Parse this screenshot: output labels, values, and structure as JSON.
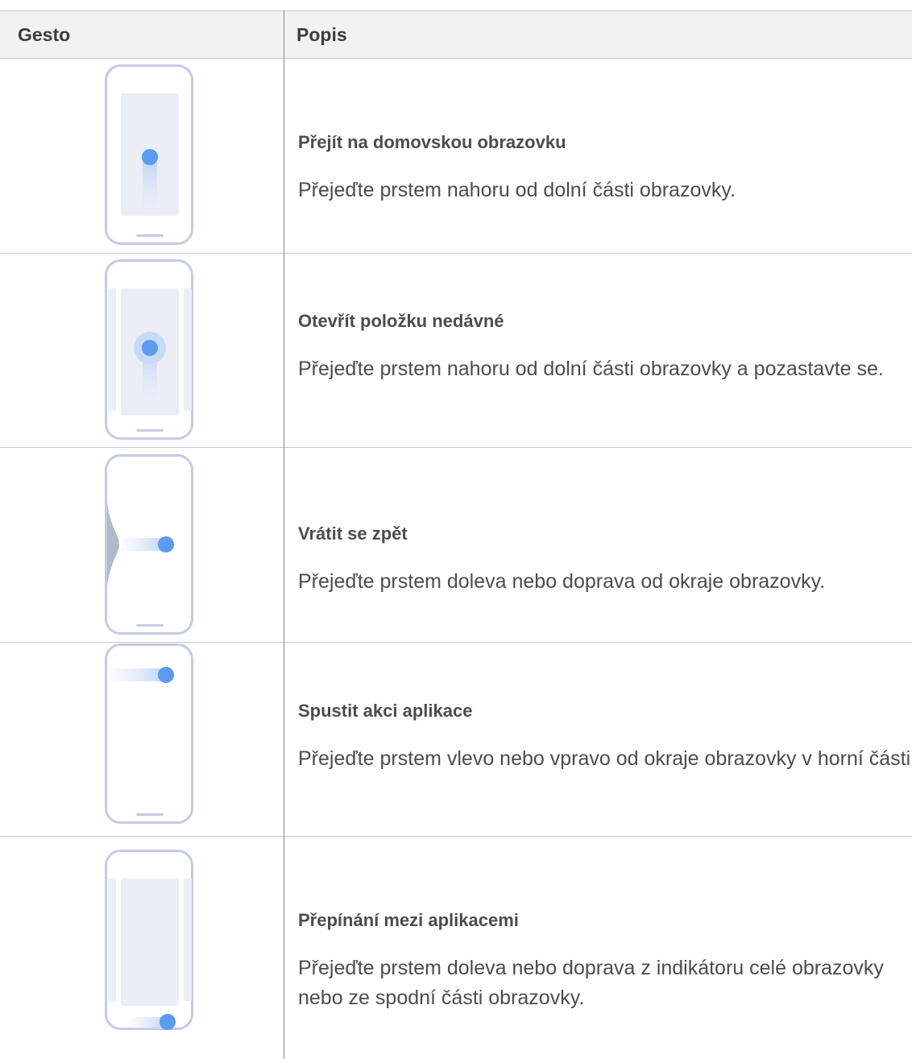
{
  "header": {
    "col_gesture": "Gesto",
    "col_description": "Popis"
  },
  "rows": [
    {
      "icon": "swipe-up-home-gesture-icon",
      "title": "Přejít na domovskou obrazovku",
      "description": "Přejeďte prstem nahoru od dolní části obrazovky."
    },
    {
      "icon": "swipe-up-hold-recents-gesture-icon",
      "title": "Otevřít položku nedávné",
      "description": "Přejeďte prstem nahoru od dolní části obrazovky a pozastavte se."
    },
    {
      "icon": "swipe-side-back-gesture-icon",
      "title": "Vrátit se zpět",
      "description": "Přejeďte prstem doleva nebo doprava od okraje obrazovky."
    },
    {
      "icon": "swipe-top-side-app-action-gesture-icon",
      "title": "Spustit akci aplikace",
      "description": "Přejeďte prstem vlevo nebo vpravo od okraje obrazovky v horní části."
    },
    {
      "icon": "swipe-bottom-switch-apps-gesture-icon",
      "title": "Přepínání mezi aplikacemi",
      "description": "Přejeďte prstem doleva nebo doprava z indikátoru celé obrazovky nebo ze spodní části obrazovky."
    }
  ],
  "colors": {
    "outline": "#c5cbe0",
    "screen": "#eceef5",
    "accent": "#5b9bf0",
    "trail": "#d3e3fb"
  }
}
